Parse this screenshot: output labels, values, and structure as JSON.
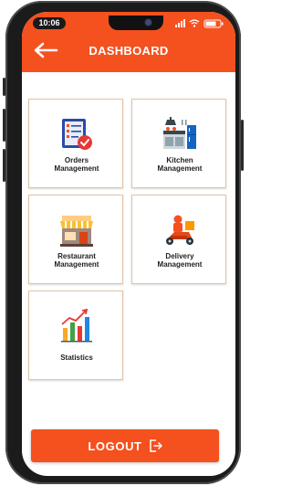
{
  "status_bar": {
    "time": "10:06"
  },
  "header": {
    "title": "DASHBOARD"
  },
  "cards": [
    {
      "line1": "Orders",
      "line2": "Management",
      "icon": "orders-checklist-icon"
    },
    {
      "line1": "Kitchen",
      "line2": "Management",
      "icon": "kitchen-icon"
    },
    {
      "line1": "Restaurant",
      "line2": "Management",
      "icon": "restaurant-storefront-icon"
    },
    {
      "line1": "Delivery",
      "line2": "Management",
      "icon": "delivery-scooter-icon"
    },
    {
      "line1": "Statistics",
      "line2": "",
      "icon": "statistics-chart-icon"
    }
  ],
  "footer": {
    "logout_label": "LOGOUT",
    "icon": "logout-icon"
  },
  "colors": {
    "accent": "#f4511e",
    "card_border": "#e0c3a8"
  }
}
